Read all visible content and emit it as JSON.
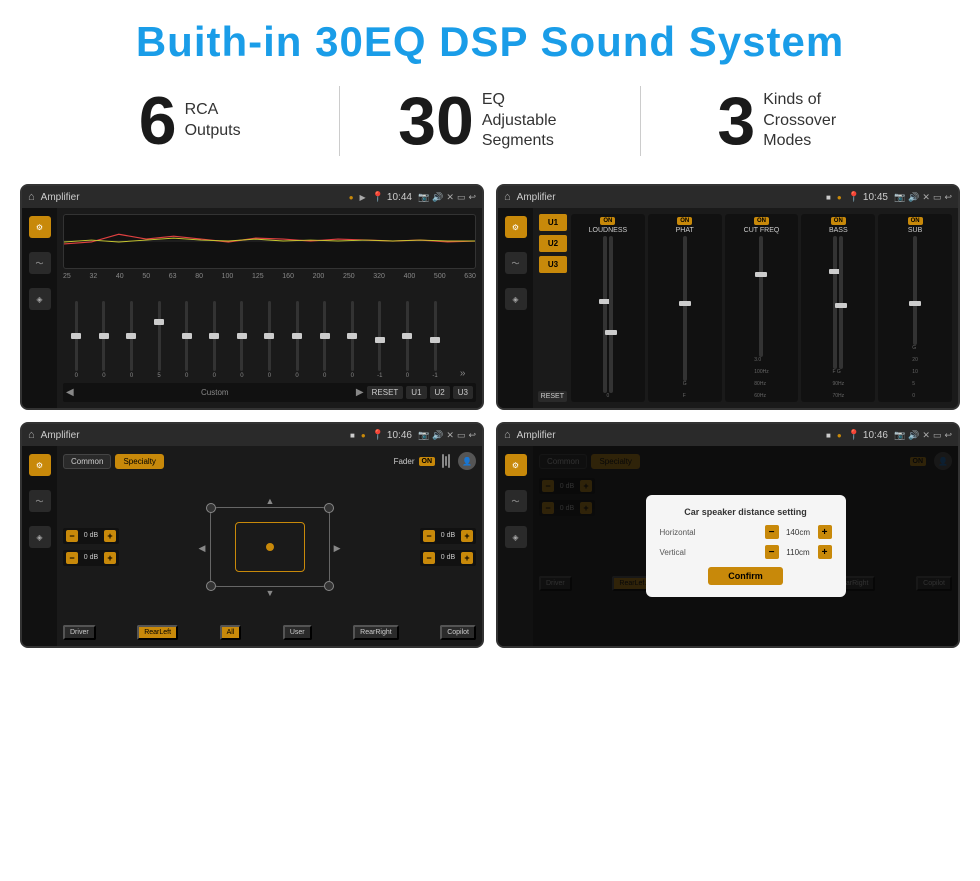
{
  "header": {
    "title": "Buith-in 30EQ DSP Sound System"
  },
  "stats": [
    {
      "number": "6",
      "text": "RCA\nOutputs"
    },
    {
      "number": "30",
      "text": "EQ Adjustable\nSegments"
    },
    {
      "number": "3",
      "text": "Kinds of\nCrossover Modes"
    }
  ],
  "screens": [
    {
      "topbar": {
        "title": "Amplifier",
        "time": "10:44"
      },
      "type": "eq"
    },
    {
      "topbar": {
        "title": "Amplifier",
        "time": "10:45"
      },
      "type": "crossover"
    },
    {
      "topbar": {
        "title": "Amplifier",
        "time": "10:46"
      },
      "type": "fader"
    },
    {
      "topbar": {
        "title": "Amplifier",
        "time": "10:46"
      },
      "type": "dialog"
    }
  ],
  "eq": {
    "freqs": [
      "25",
      "32",
      "40",
      "50",
      "63",
      "80",
      "100",
      "125",
      "160",
      "200",
      "250",
      "320",
      "400",
      "500",
      "630"
    ],
    "values": [
      "0",
      "0",
      "0",
      "5",
      "0",
      "0",
      "0",
      "0",
      "0",
      "0",
      "0",
      "-1",
      "0",
      "-1"
    ],
    "bottom_btns": [
      "RESET",
      "U1",
      "U2",
      "U3"
    ],
    "label": "Custom"
  },
  "crossover": {
    "presets": [
      "U1",
      "U2",
      "U3"
    ],
    "params": [
      "LOUDNESS",
      "PHAT",
      "CUT FREQ",
      "BASS",
      "SUB"
    ],
    "reset_label": "RESET"
  },
  "fader": {
    "tabs": [
      "Common",
      "Specialty"
    ],
    "fader_label": "Fader",
    "on_label": "ON",
    "db_values": [
      "0 dB",
      "0 dB",
      "0 dB",
      "0 dB"
    ],
    "bottom_btns": [
      "Driver",
      "RearLeft",
      "All",
      "User",
      "RearRight",
      "Copilot"
    ]
  },
  "dialog": {
    "title": "Car speaker distance setting",
    "horizontal_label": "Horizontal",
    "horizontal_value": "140cm",
    "vertical_label": "Vertical",
    "vertical_value": "110cm",
    "confirm_label": "Confirm"
  }
}
